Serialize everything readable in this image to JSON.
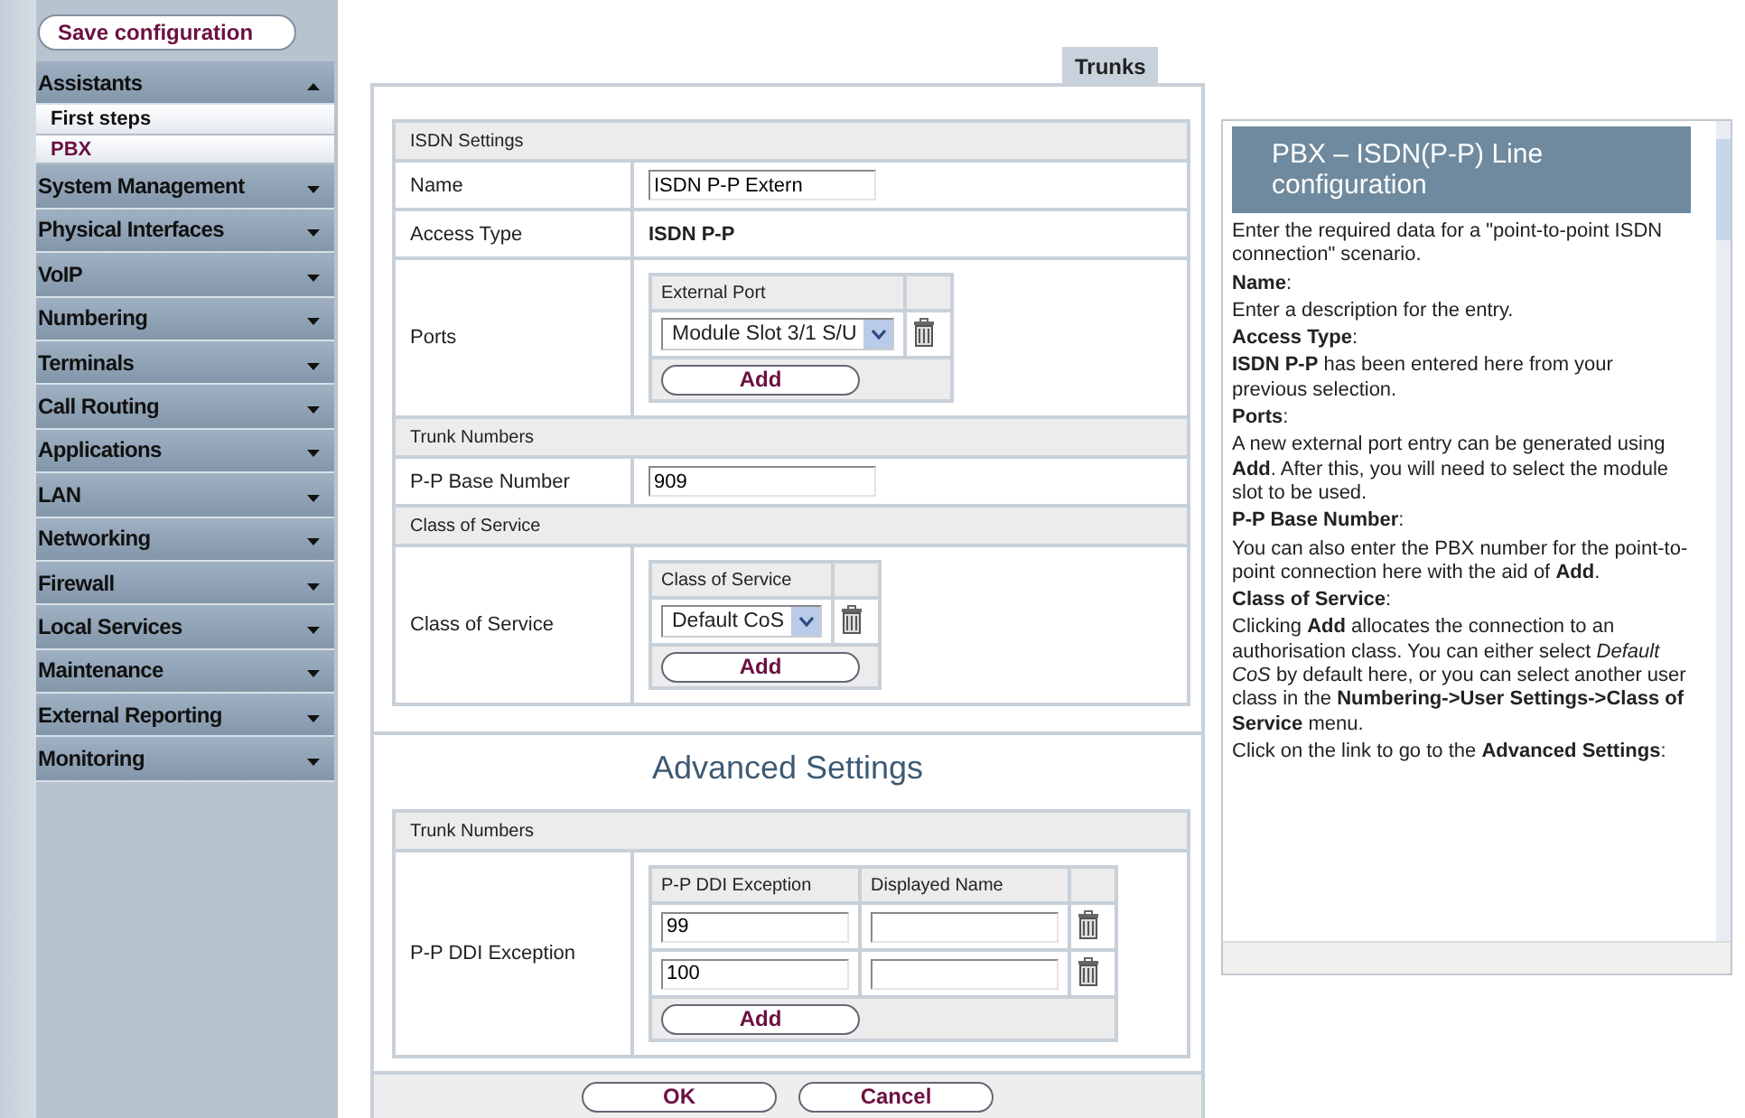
{
  "sidebar": {
    "save_button": "Save configuration",
    "menu": [
      {
        "label": "Assistants",
        "expanded": true,
        "children": [
          {
            "label": "First steps",
            "selected": false
          },
          {
            "label": "PBX",
            "selected": true
          }
        ]
      },
      {
        "label": "System Management",
        "expanded": false
      },
      {
        "label": "Physical Interfaces",
        "expanded": false
      },
      {
        "label": "VoIP",
        "expanded": false
      },
      {
        "label": "Numbering",
        "expanded": false
      },
      {
        "label": "Terminals",
        "expanded": false
      },
      {
        "label": "Call Routing",
        "expanded": false
      },
      {
        "label": "Applications",
        "expanded": false
      },
      {
        "label": "LAN",
        "expanded": false
      },
      {
        "label": "Networking",
        "expanded": false
      },
      {
        "label": "Firewall",
        "expanded": false
      },
      {
        "label": "Local Services",
        "expanded": false
      },
      {
        "label": "Maintenance",
        "expanded": false
      },
      {
        "label": "External Reporting",
        "expanded": false
      },
      {
        "label": "Monitoring",
        "expanded": false
      }
    ]
  },
  "page_title": "Trunks",
  "form": {
    "sections": [
      {
        "title": "ISDN Settings",
        "rows": [
          {
            "kind": "input",
            "label": "Name",
            "value": "ISDN P-P Extern"
          },
          {
            "kind": "text",
            "label": "Access Type",
            "value": "ISDN P-P"
          },
          {
            "kind": "list",
            "label": "Ports",
            "columns": [
              "External Port"
            ],
            "rows": [
              {
                "cells": [
                  {
                    "kind": "select",
                    "value": "Module Slot 3/1 S/U"
                  }
                ]
              }
            ],
            "add_button": "Add"
          }
        ]
      },
      {
        "title": "Trunk Numbers",
        "rows": [
          {
            "kind": "input",
            "label": "P-P Base Number",
            "value": "909"
          }
        ]
      },
      {
        "title": "Class of Service",
        "rows": [
          {
            "kind": "list",
            "label": "Class of Service",
            "columns": [
              "Class of Service"
            ],
            "rows": [
              {
                "cells": [
                  {
                    "kind": "select",
                    "value": "Default CoS"
                  }
                ]
              }
            ],
            "add_button": "Add"
          }
        ]
      }
    ],
    "advanced": {
      "heading": "Advanced Settings",
      "sections": [
        {
          "title": "Trunk Numbers",
          "rows": [
            {
              "kind": "list",
              "label": "P-P DDI Exception",
              "columns": [
                "P-P DDI Exception",
                "Displayed Name"
              ],
              "rows": [
                {
                  "cells": [
                    {
                      "kind": "input",
                      "value": "99"
                    },
                    {
                      "kind": "input"
                    }
                  ]
                },
                {
                  "cells": [
                    {
                      "kind": "input",
                      "value": "100"
                    },
                    {
                      "kind": "input"
                    }
                  ]
                }
              ],
              "add_button": "Add"
            }
          ]
        }
      ]
    },
    "buttons": [
      "OK",
      "Cancel"
    ]
  },
  "help": {
    "title": "PBX – ISDN(P-P) Line configuration",
    "paragraphs": [
      "Enter the required data for a \"point-to-point ISDN connection\" scenario.",
      "**Name**:",
      "Enter a description for the entry.",
      "**Access Type**:",
      "**ISDN P-P** has been entered here from your previous selection.",
      "**Ports**:",
      "A new external port entry can be generated using **Add**. After this, you will need to select the module slot to be used.",
      "**P-P Base Number**:",
      "You can also enter the PBX number for the point-to-point connection here with the aid of **Add**.",
      "**Class of Service**:",
      "Clicking **Add** allocates the connection to an authorisation class. You can either select *Default CoS* by default here, or you can select another user class in the **Numbering->User Settings->Class of Service** menu.",
      "Click on the link to go to the **Advanced Settings**:"
    ]
  }
}
